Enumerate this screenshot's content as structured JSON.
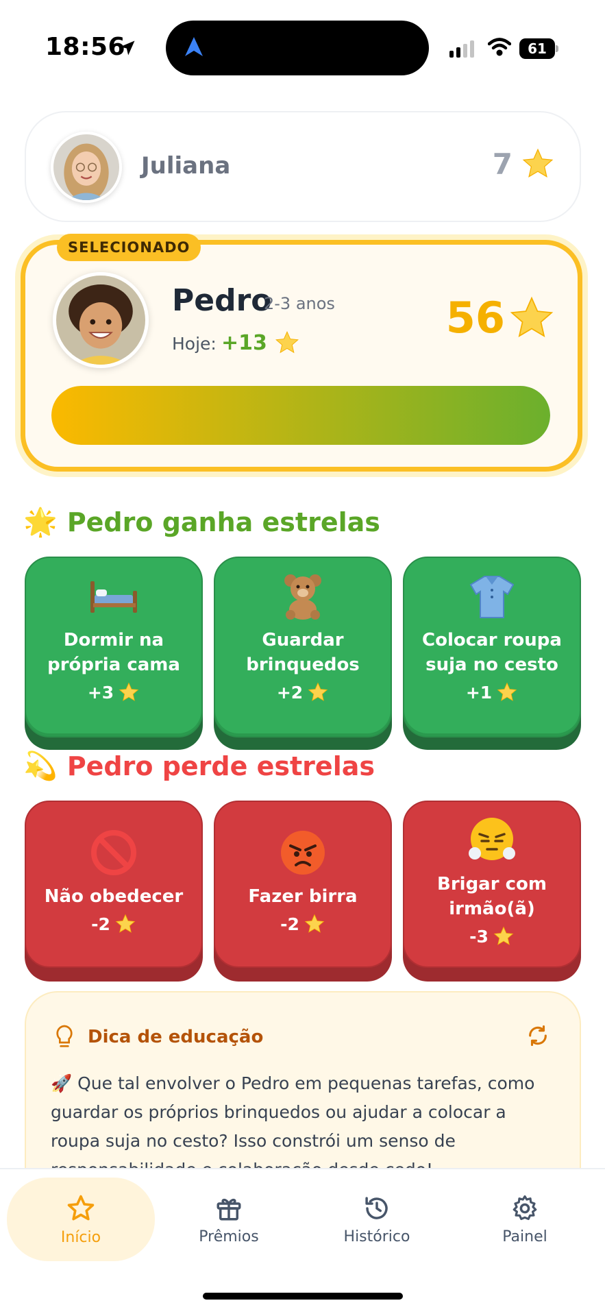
{
  "status_bar": {
    "time": "18:56",
    "battery": "61"
  },
  "other_kid": {
    "name": "Juliana",
    "stars": "7"
  },
  "selected": {
    "badge": "SELECIONADO",
    "name": "Pedro",
    "age": "2-3 anos",
    "today_label": "Hoje:",
    "today_value": "+13",
    "total_stars": "56",
    "progress": 1.0
  },
  "earn": {
    "title": "Pedro ganha estrelas",
    "title_emoji": "🌟",
    "items": [
      {
        "icon": "bed-icon",
        "label_line1": "Dormir na",
        "label_line2": "própria cama",
        "points": "+3"
      },
      {
        "icon": "teddy-bear-icon",
        "label_line1": "Guardar",
        "label_line2": "brinquedos",
        "points": "+2"
      },
      {
        "icon": "shirt-icon",
        "label_line1": "Colocar roupa",
        "label_line2": "suja no cesto",
        "points": "+1"
      }
    ]
  },
  "lose": {
    "title": "Pedro perde estrelas",
    "title_emoji": "💫",
    "items": [
      {
        "icon": "prohibited-icon",
        "label_line1": "Não obedecer",
        "label_line2": "",
        "points": "-2"
      },
      {
        "icon": "angry-face-icon",
        "label_line1": "Fazer birra",
        "label_line2": "",
        "points": "-2"
      },
      {
        "icon": "steam-face-icon",
        "label_line1": "Brigar com",
        "label_line2": "irmão(ã)",
        "points": "-3"
      }
    ]
  },
  "tip": {
    "title": "Dica de educação",
    "emoji": "🚀",
    "text": "Que tal envolver o Pedro em pequenas tarefas, como guardar os próprios brinquedos ou ajudar a colocar a roupa suja no cesto? Isso constrói um senso de responsabilidade e colaboração desde cedo!"
  },
  "nav": {
    "items": [
      {
        "label": "Início",
        "icon": "star-icon",
        "active": true
      },
      {
        "label": "Prêmios",
        "icon": "gift-icon",
        "active": false
      },
      {
        "label": "Histórico",
        "icon": "history-icon",
        "active": false
      },
      {
        "label": "Painel",
        "icon": "gear-icon",
        "active": false
      }
    ]
  },
  "colors": {
    "accent": "#fbbf24",
    "earn": "#33ae5b",
    "lose": "#d23b3f",
    "earn_title": "#5aa627",
    "lose_title": "#ef4444"
  }
}
